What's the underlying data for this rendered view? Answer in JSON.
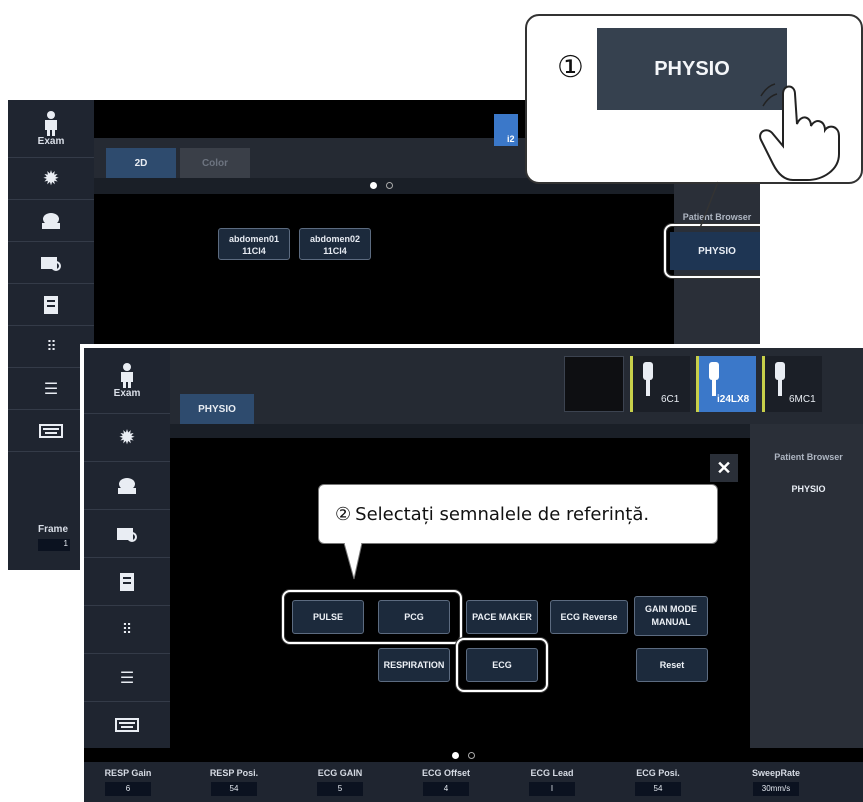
{
  "colors": {
    "accent": "#2e4b6e",
    "panel": "#1f2530",
    "highlight": "#ffffff"
  },
  "screen1": {
    "sidebar": {
      "exam_label": "Exam",
      "frame_label": "Frame",
      "frame_value": "1",
      "icons": [
        "person-icon",
        "gear-icon",
        "preset-icon",
        "folder-search-icon",
        "report-icon",
        "grid-icon",
        "list-icon",
        "keyboard-icon"
      ]
    },
    "tabs": [
      "2D",
      "Color"
    ],
    "presets": [
      {
        "name": "abdomen01",
        "probe": "11Cl4"
      },
      {
        "name": "abdomen02",
        "probe": "11Cl4"
      }
    ],
    "right_panel": {
      "patient_browser": "Patient Browser",
      "physio_button": "PHYSIO"
    },
    "probe_partial": "i2"
  },
  "callout1": {
    "number": "①",
    "button_label": "PHYSIO"
  },
  "screen2": {
    "sidebar": {
      "exam_label": "Exam"
    },
    "tab": "PHYSIO",
    "probes": [
      {
        "label": ""
      },
      {
        "label": "6C1"
      },
      {
        "label": "i24LX8"
      },
      {
        "label": "6MC1"
      }
    ],
    "right_panel": {
      "patient_browser": "Patient Browser",
      "physio_label": "PHYSIO"
    },
    "close_symbol": "✕",
    "buttons": {
      "pulse": "PULSE",
      "pcg": "PCG",
      "pace_maker": "PACE MAKER",
      "ecg_reverse": "ECG Reverse",
      "gain_mode_1": "GAIN MODE",
      "gain_mode_2": "MANUAL",
      "respiration": "RESPIRATION",
      "ecg": "ECG",
      "reset": "Reset"
    },
    "params": [
      {
        "label": "RESP Gain",
        "value": "6"
      },
      {
        "label": "RESP Posi.",
        "value": "54"
      },
      {
        "label": "ECG GAIN",
        "value": "5"
      },
      {
        "label": "ECG Offset",
        "value": "4"
      },
      {
        "label": "ECG Lead",
        "value": "I"
      },
      {
        "label": "ECG Posi.",
        "value": "54"
      },
      {
        "label": "SweepRate",
        "value": "30mm/s"
      }
    ]
  },
  "callout2": {
    "number": "②",
    "text": "Selectați semnalele de referință."
  }
}
